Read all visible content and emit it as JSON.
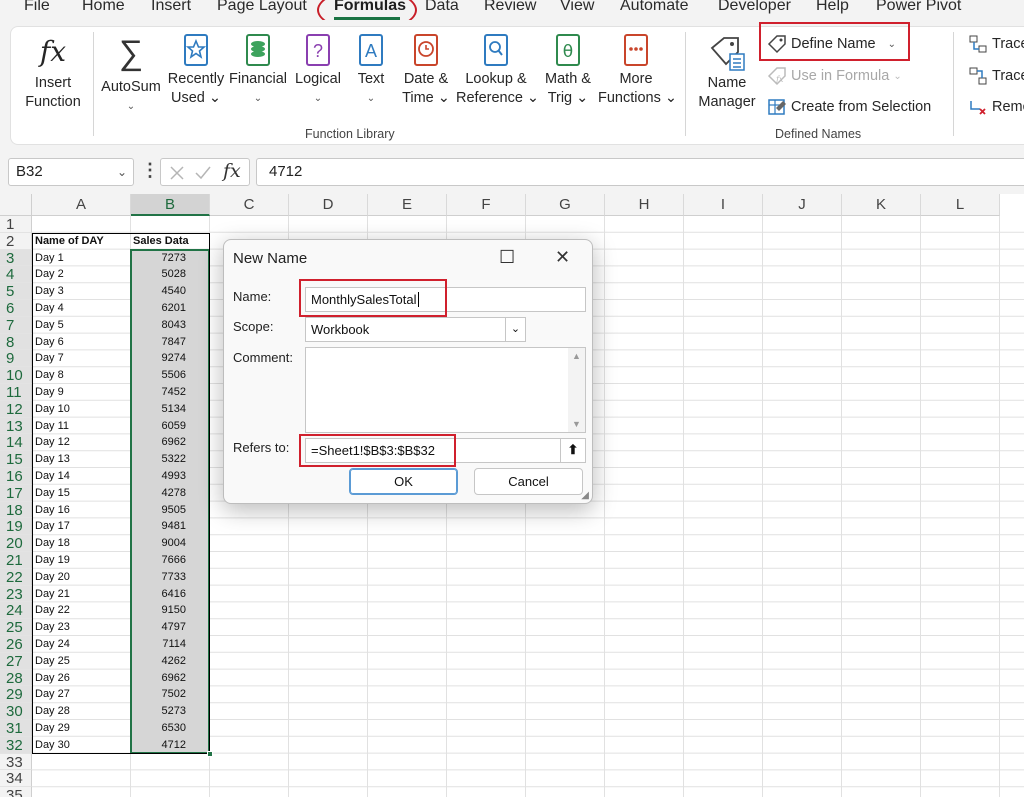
{
  "menu": {
    "items": [
      "File",
      "Home",
      "Insert",
      "Page Layout",
      "Formulas",
      "Data",
      "Review",
      "View",
      "Automate",
      "Developer",
      "Help",
      "Power Pivot"
    ],
    "active": "Formulas"
  },
  "ribbon": {
    "insert_function": {
      "line1": "Insert",
      "line2": "Function",
      "icon": "fx-icon"
    },
    "function_library": {
      "label": "Function Library",
      "buttons": [
        {
          "line1": "AutoSum",
          "line2": "⌄",
          "icon": "sigma-icon"
        },
        {
          "line1": "Recently",
          "line2": "Used ⌄",
          "icon": "star-book-icon"
        },
        {
          "line1": "Financial",
          "line2": "⌄",
          "icon": "coins-book-icon"
        },
        {
          "line1": "Logical",
          "line2": "⌄",
          "icon": "question-book-icon"
        },
        {
          "line1": "Text",
          "line2": "⌄",
          "icon": "text-book-icon"
        },
        {
          "line1": "Date &",
          "line2": "Time ⌄",
          "icon": "clock-book-icon"
        },
        {
          "line1": "Lookup &",
          "line2": "Reference ⌄",
          "icon": "magnifier-book-icon"
        },
        {
          "line1": "Math &",
          "line2": "Trig ⌄",
          "icon": "theta-book-icon"
        },
        {
          "line1": "More",
          "line2": "Functions ⌄",
          "icon": "dots-book-icon"
        }
      ]
    },
    "defined_names": {
      "label": "Defined Names",
      "name_manager": {
        "line1": "Name",
        "line2": "Manager"
      },
      "define_name": "Define Name",
      "use_in_formula": "Use in Formula",
      "create_from_selection": "Create from Selection"
    },
    "formula_auditing": {
      "trace_precedents": "Trace",
      "trace_dependents": "Trace",
      "remove_arrows": "Remo"
    }
  },
  "formula_bar": {
    "name_box": "B32",
    "fx": "fx",
    "value": "4712"
  },
  "sheet": {
    "columns": [
      "A",
      "B",
      "C",
      "D",
      "E",
      "F",
      "G",
      "H",
      "I",
      "J",
      "K",
      "L"
    ],
    "rows": [
      "1",
      "2",
      "3",
      "4",
      "5",
      "6",
      "7",
      "8",
      "9",
      "10",
      "11",
      "12",
      "13",
      "14",
      "15",
      "16",
      "17",
      "18",
      "19",
      "20",
      "21",
      "22",
      "23",
      "24",
      "25",
      "26",
      "27",
      "28",
      "29",
      "30",
      "31",
      "32",
      "33",
      "34",
      "35"
    ],
    "header": {
      "a": "Name of DAY",
      "b": "Sales Data"
    },
    "data": [
      [
        "Day 1",
        "7273"
      ],
      [
        "Day 2",
        "5028"
      ],
      [
        "Day 3",
        "4540"
      ],
      [
        "Day 4",
        "6201"
      ],
      [
        "Day 5",
        "8043"
      ],
      [
        "Day 6",
        "7847"
      ],
      [
        "Day 7",
        "9274"
      ],
      [
        "Day 8",
        "5506"
      ],
      [
        "Day 9",
        "7452"
      ],
      [
        "Day 10",
        "5134"
      ],
      [
        "Day 11",
        "6059"
      ],
      [
        "Day 12",
        "6962"
      ],
      [
        "Day 13",
        "5322"
      ],
      [
        "Day 14",
        "4993"
      ],
      [
        "Day 15",
        "4278"
      ],
      [
        "Day 16",
        "9505"
      ],
      [
        "Day 17",
        "9481"
      ],
      [
        "Day 18",
        "9004"
      ],
      [
        "Day 19",
        "7666"
      ],
      [
        "Day 20",
        "7733"
      ],
      [
        "Day 21",
        "6416"
      ],
      [
        "Day 22",
        "9150"
      ],
      [
        "Day 23",
        "4797"
      ],
      [
        "Day 24",
        "7114"
      ],
      [
        "Day 25",
        "4262"
      ],
      [
        "Day 26",
        "6962"
      ],
      [
        "Day 27",
        "7502"
      ],
      [
        "Day 28",
        "5273"
      ],
      [
        "Day 29",
        "6530"
      ],
      [
        "Day 30",
        "4712"
      ]
    ]
  },
  "dialog": {
    "title": "New Name",
    "name_label": "Name:",
    "name_value": "MonthlySalesTotal",
    "scope_label": "Scope:",
    "scope_value": "Workbook",
    "comment_label": "Comment:",
    "comment_value": "",
    "refers_label": "Refers to:",
    "refers_value": "=Sheet1!$B$3:$B$32",
    "ok": "OK",
    "cancel": "Cancel"
  },
  "colors": {
    "annotation_red": "#d0202d",
    "excel_green": "#217346",
    "selection_fill": "#d6d6d6"
  }
}
